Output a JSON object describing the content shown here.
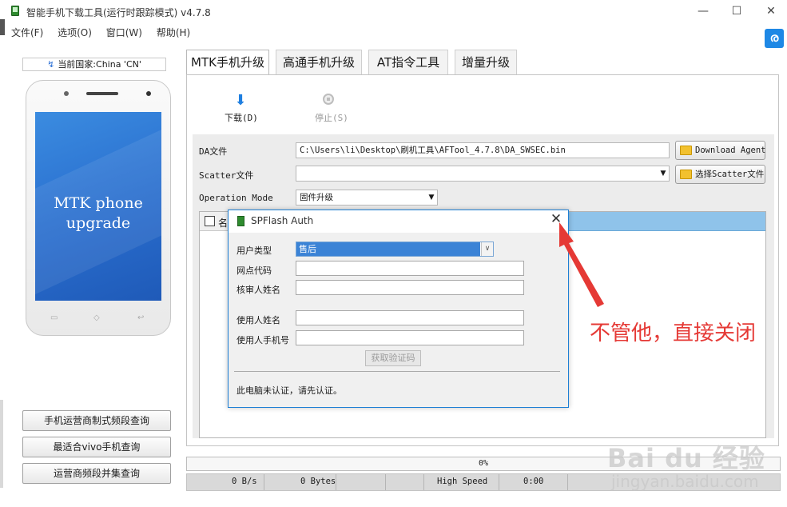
{
  "window": {
    "title": "智能手机下载工具(运行时跟踪模式)  v4.7.8",
    "minimize": "—",
    "maximize": "☐",
    "close": "✕"
  },
  "menu": [
    "文件(F)",
    "选项(O)",
    "窗口(W)",
    "帮助(H)"
  ],
  "side_logo_glyph": "ര",
  "left_panel": {
    "country": "当前国家:China 'CN'",
    "country_icon": "↯",
    "phone_text_line1": "MTK phone",
    "phone_text_line2": "upgrade",
    "nav_back": "▭",
    "nav_home": "◇",
    "nav_recent": "↩",
    "buttons": [
      "手机运营商制式频段查询",
      "最适合vivo手机查询",
      "运营商频段并集查询"
    ]
  },
  "tabs": [
    "MTK手机升级",
    "高通手机升级",
    "AT指令工具",
    "增量升级"
  ],
  "toolbar": {
    "download_icon": "⬇",
    "download": "下载(D)",
    "stop": "停止(S)"
  },
  "config": {
    "da_label": "DA文件",
    "da_value": "C:\\Users\\li\\Desktop\\刷机工具\\AFTool_4.7.8\\DA_SWSEC.bin",
    "da_button": "Download Agent",
    "scatter_label": "Scatter文件",
    "scatter_value": "",
    "scatter_button": "选择Scatter文件",
    "mode_label": "Operation Mode",
    "mode_value": "固件升级",
    "dropdown_arrow": "▼",
    "list_name_header": "名"
  },
  "progress": {
    "percent": "0%"
  },
  "status": {
    "speed": "0 B/s",
    "bytes": "0 Bytes",
    "mode": "High Speed",
    "time": "0:00"
  },
  "dialog": {
    "title": "SPFlash Auth",
    "close": "✕",
    "user_type_label": "用户类型",
    "user_type_value": "售后",
    "select_arrow": "∨",
    "site_code_label": "网点代码",
    "reviewer_label": "核审人姓名",
    "user_name_label": "使用人姓名",
    "user_phone_label": "使用人手机号",
    "get_code_button": "获取验证码",
    "status": "此电脑未认证，请先认证。"
  },
  "annotation": "不管他，直接关闭",
  "watermark": {
    "logo": "Bai du 经验",
    "url": "jingyan.baidu.com"
  },
  "colors": {
    "accent_blue": "#1e7fd4",
    "selected_blue": "#3b83d6",
    "annotation_red": "#e53935",
    "phone_screen": "#2a6fcf"
  }
}
